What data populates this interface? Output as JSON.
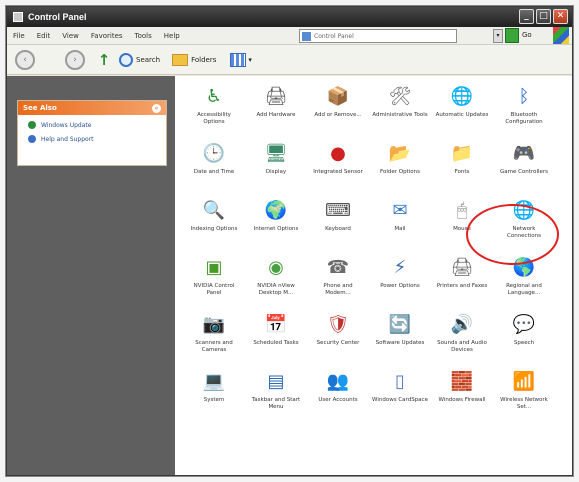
{
  "window": {
    "title": "Control Panel"
  },
  "window_buttons": {
    "minimize": "_",
    "maximize": "□",
    "close": "✕"
  },
  "menu": [
    "File",
    "Edit",
    "View",
    "Favorites",
    "Tools",
    "Help"
  ],
  "address": {
    "value": "Control Panel",
    "go_label": "Go"
  },
  "toolbar": {
    "back": "‹",
    "forward": "›",
    "up": "↑",
    "search_label": "Search",
    "folders_label": "Folders",
    "view_caret": "▾"
  },
  "see_also": {
    "title": "See Also",
    "chevron": "«",
    "links": [
      {
        "label": "Windows Update",
        "color": "#2e8b3a"
      },
      {
        "label": "Help and Support",
        "color": "#3a6fc6"
      }
    ]
  },
  "items": [
    {
      "label": "Accessibility Options",
      "icon": "♿",
      "color": "#2f8f3a",
      "name": "accessibility-icon"
    },
    {
      "label": "Add Hardware",
      "icon": "🖨",
      "color": "#555",
      "name": "hardware-icon"
    },
    {
      "label": "Add or Remove...",
      "icon": "📦",
      "color": "#5a7fc0",
      "name": "programs-icon"
    },
    {
      "label": "Administrative Tools",
      "icon": "🛠",
      "color": "#6a6a6a",
      "name": "admin-tools-icon"
    },
    {
      "label": "Automatic Updates",
      "icon": "🌐",
      "color": "#2a8fd0",
      "name": "globe-update-icon"
    },
    {
      "label": "Bluetooth Configuration",
      "icon": "ᛒ",
      "color": "#1e5fc8",
      "name": "bluetooth-icon"
    },
    {
      "label": "Date and Time",
      "icon": "🕒",
      "color": "#3a6fb0",
      "name": "clock-icon"
    },
    {
      "label": "Display",
      "icon": "🖥",
      "color": "#3a8a6a",
      "name": "display-icon"
    },
    {
      "label": "Integrated Sensor",
      "icon": "●",
      "color": "#d02020",
      "name": "sensor-icon"
    },
    {
      "label": "Folder Options",
      "icon": "📂",
      "color": "#e6b830",
      "name": "folder-options-icon"
    },
    {
      "label": "Fonts",
      "icon": "📁",
      "color": "#e6b830",
      "name": "fonts-icon"
    },
    {
      "label": "Game Controllers",
      "icon": "🎮",
      "color": "#7a4fa0",
      "name": "game-controller-icon"
    },
    {
      "label": "Indexing Options",
      "icon": "🔍",
      "color": "#777",
      "name": "indexing-icon"
    },
    {
      "label": "Internet Options",
      "icon": "🌍",
      "color": "#2f7fc0",
      "name": "internet-icon"
    },
    {
      "label": "Keyboard",
      "icon": "⌨",
      "color": "#555",
      "name": "keyboard-icon"
    },
    {
      "label": "Mail",
      "icon": "✉",
      "color": "#3a7ac0",
      "name": "mail-icon"
    },
    {
      "label": "Mouse",
      "icon": "🖱",
      "color": "#888",
      "name": "mouse-icon"
    },
    {
      "label": "Network Connections",
      "icon": "🌐",
      "color": "#1e7fb8",
      "name": "network-icon"
    },
    {
      "label": "NVIDIA Control Panel",
      "icon": "▣",
      "color": "#4a9a2a",
      "name": "nvidia-icon"
    },
    {
      "label": "NVIDIA nView Desktop M...",
      "icon": "◉",
      "color": "#4aa040",
      "name": "nview-icon"
    },
    {
      "label": "Phone and Modem...",
      "icon": "☎",
      "color": "#6a6a6a",
      "name": "phone-icon"
    },
    {
      "label": "Power Options",
      "icon": "⚡",
      "color": "#3a6ab8",
      "name": "power-icon"
    },
    {
      "label": "Printers and Faxes",
      "icon": "🖨",
      "color": "#666",
      "name": "printer-icon"
    },
    {
      "label": "Regional and Language...",
      "icon": "🌎",
      "color": "#2f8f6a",
      "name": "regional-icon"
    },
    {
      "label": "Scanners and Cameras",
      "icon": "📷",
      "color": "#555",
      "name": "scanner-icon"
    },
    {
      "label": "Scheduled Tasks",
      "icon": "📅",
      "color": "#d0a030",
      "name": "tasks-icon"
    },
    {
      "label": "Security Center",
      "icon": "🛡",
      "color": "#c03030",
      "name": "shield-icon"
    },
    {
      "label": "Software Updates",
      "icon": "🔄",
      "color": "#2a5fa0",
      "name": "software-update-icon"
    },
    {
      "label": "Sounds and Audio Devices",
      "icon": "🔊",
      "color": "#555",
      "name": "speaker-icon"
    },
    {
      "label": "Speech",
      "icon": "💬",
      "color": "#3a9a3a",
      "name": "speech-icon"
    },
    {
      "label": "System",
      "icon": "💻",
      "color": "#3a6ab8",
      "name": "system-icon"
    },
    {
      "label": "Taskbar and Start Menu",
      "icon": "▤",
      "color": "#2a6ab8",
      "name": "taskbar-icon"
    },
    {
      "label": "User Accounts",
      "icon": "👥",
      "color": "#3a6ab8",
      "name": "users-icon"
    },
    {
      "label": "Windows CardSpace",
      "icon": "▯",
      "color": "#5a7ac0",
      "name": "cardspace-icon"
    },
    {
      "label": "Windows Firewall",
      "icon": "🧱",
      "color": "#c04020",
      "name": "firewall-icon"
    },
    {
      "label": "Wireless Network Set...",
      "icon": "📶",
      "color": "#3a8a3a",
      "name": "wireless-icon"
    }
  ]
}
